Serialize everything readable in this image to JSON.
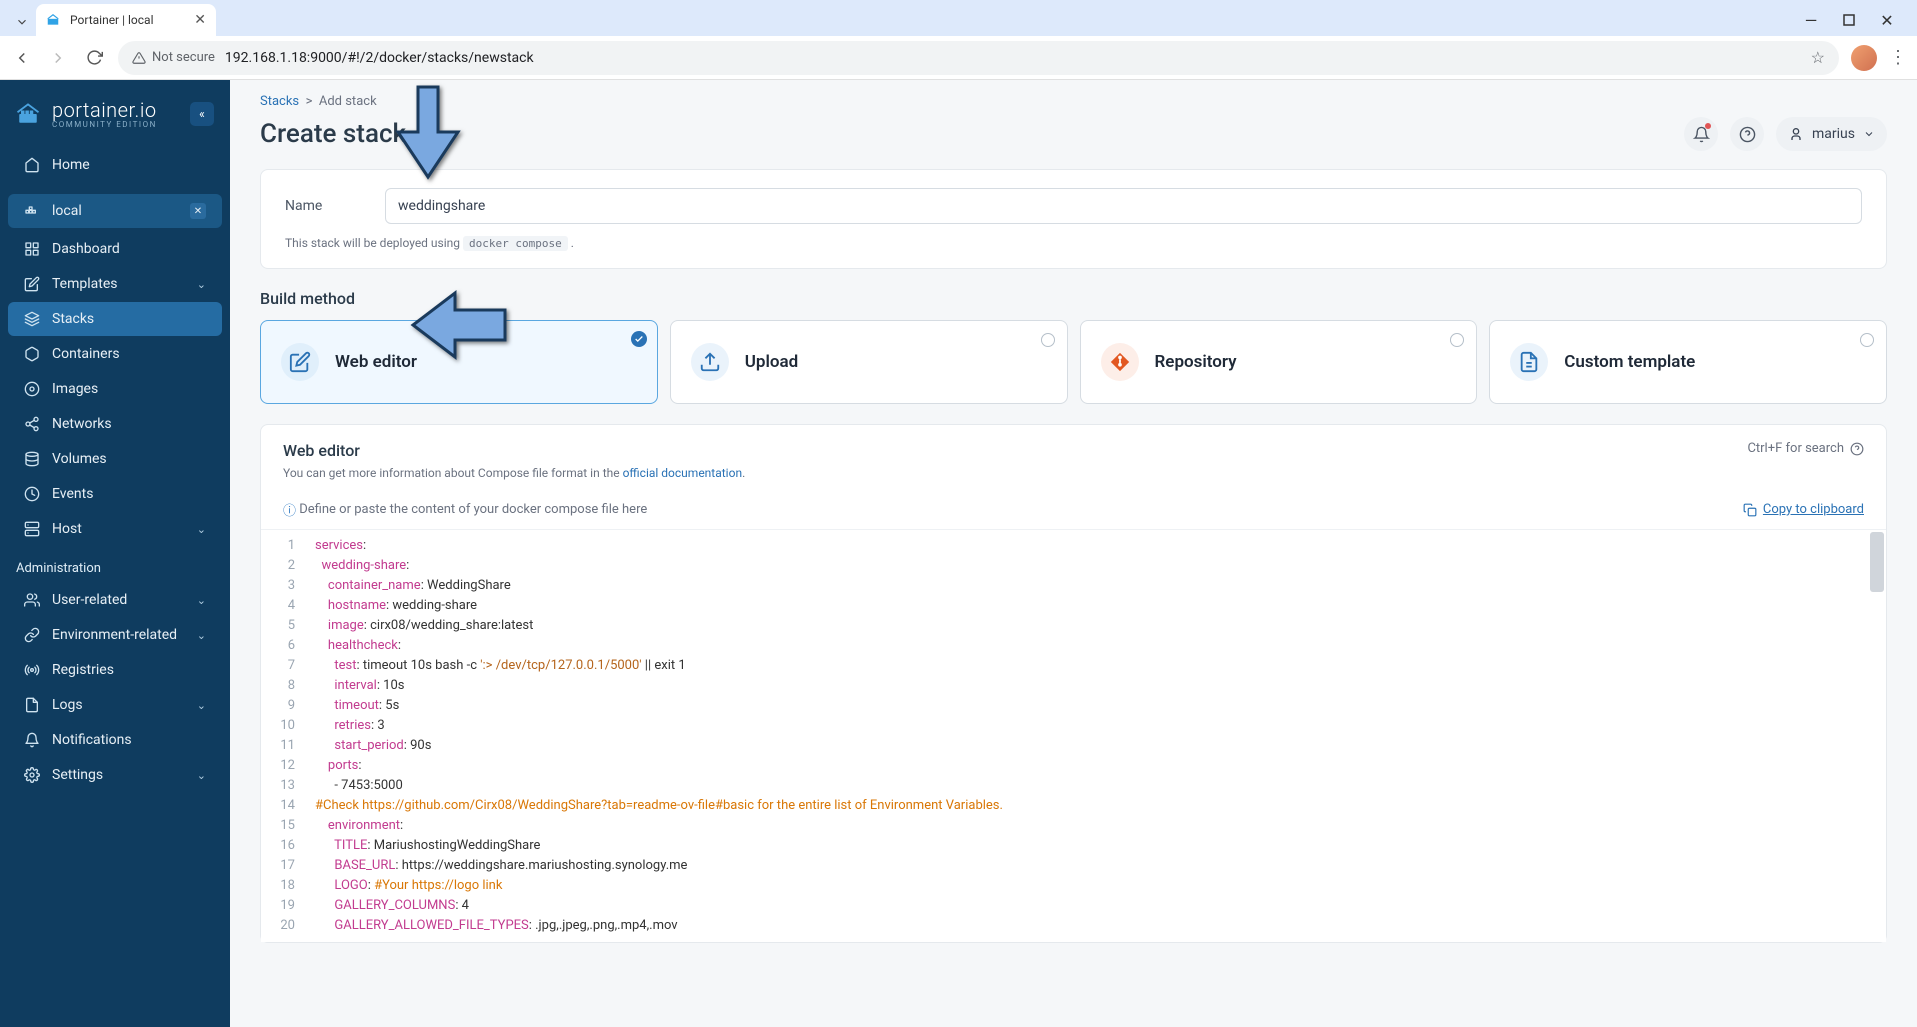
{
  "browser": {
    "tab_title": "Portainer | local",
    "not_secure_label": "Not secure",
    "url": "192.168.1.18:9000/#!/2/docker/stacks/newstack"
  },
  "sidebar": {
    "brand": "portainer.io",
    "edition": "COMMUNITY EDITION",
    "items": [
      {
        "label": "Home",
        "icon": "home"
      },
      {
        "label": "local",
        "icon": "docker",
        "env": true
      },
      {
        "label": "Dashboard",
        "icon": "grid"
      },
      {
        "label": "Templates",
        "icon": "edit",
        "expandable": true
      },
      {
        "label": "Stacks",
        "icon": "layers",
        "active": true
      },
      {
        "label": "Containers",
        "icon": "box"
      },
      {
        "label": "Images",
        "icon": "disc"
      },
      {
        "label": "Networks",
        "icon": "share"
      },
      {
        "label": "Volumes",
        "icon": "database"
      },
      {
        "label": "Events",
        "icon": "clock"
      },
      {
        "label": "Host",
        "icon": "server",
        "expandable": true
      }
    ],
    "admin_label": "Administration",
    "admin_items": [
      {
        "label": "User-related",
        "icon": "users",
        "expandable": true
      },
      {
        "label": "Environment-related",
        "icon": "link",
        "expandable": true
      },
      {
        "label": "Registries",
        "icon": "radio"
      },
      {
        "label": "Logs",
        "icon": "file",
        "expandable": true
      },
      {
        "label": "Notifications",
        "icon": "bell"
      },
      {
        "label": "Settings",
        "icon": "gear",
        "expandable": true
      }
    ]
  },
  "header": {
    "breadcrumb_parent": "Stacks",
    "breadcrumb_current": "Add stack",
    "title": "Create stack",
    "username": "marius"
  },
  "form": {
    "name_label": "Name",
    "name_value": "weddingshare",
    "deploy_note_pre": "This stack will be deployed using ",
    "deploy_cmd": "docker compose",
    "deploy_note_post": " ."
  },
  "build": {
    "section": "Build method",
    "methods": [
      {
        "label": "Web editor",
        "selected": true,
        "color": "#2a72b5"
      },
      {
        "label": "Upload",
        "color": "#2a72b5"
      },
      {
        "label": "Repository",
        "color": "#e25822"
      },
      {
        "label": "Custom template",
        "color": "#2a72b5"
      }
    ]
  },
  "editor": {
    "title": "Web editor",
    "sub_pre": "You can get more information about Compose file format in the ",
    "sub_link": "official documentation",
    "search_hint": "Ctrl+F for search",
    "placeholder": "Define or paste the content of your docker compose file here",
    "copy_label": "Copy to clipboard",
    "lines": [
      [
        {
          "t": "services",
          "c": "k-key"
        },
        {
          "t": ":"
        }
      ],
      [
        {
          "t": "  "
        },
        {
          "t": "wedding-share",
          "c": "k-key"
        },
        {
          "t": ":"
        }
      ],
      [
        {
          "t": "    "
        },
        {
          "t": "container_name",
          "c": "k-key"
        },
        {
          "t": ": WeddingShare"
        }
      ],
      [
        {
          "t": "    "
        },
        {
          "t": "hostname",
          "c": "k-key"
        },
        {
          "t": ": wedding-share"
        }
      ],
      [
        {
          "t": "    "
        },
        {
          "t": "image",
          "c": "k-key"
        },
        {
          "t": ": cirx08/wedding_share:latest"
        }
      ],
      [
        {
          "t": "    "
        },
        {
          "t": "healthcheck",
          "c": "k-key"
        },
        {
          "t": ":"
        }
      ],
      [
        {
          "t": "      "
        },
        {
          "t": "test",
          "c": "k-key"
        },
        {
          "t": ": timeout 10s bash -c "
        },
        {
          "t": "':> /dev/tcp/127.0.0.1/5000'",
          "c": "k-str"
        },
        {
          "t": " || exit 1"
        }
      ],
      [
        {
          "t": "      "
        },
        {
          "t": "interval",
          "c": "k-key"
        },
        {
          "t": ": 10s"
        }
      ],
      [
        {
          "t": "      "
        },
        {
          "t": "timeout",
          "c": "k-key"
        },
        {
          "t": ": 5s"
        }
      ],
      [
        {
          "t": "      "
        },
        {
          "t": "retries",
          "c": "k-key"
        },
        {
          "t": ": 3"
        }
      ],
      [
        {
          "t": "      "
        },
        {
          "t": "start_period",
          "c": "k-key"
        },
        {
          "t": ": 90s"
        }
      ],
      [
        {
          "t": "    "
        },
        {
          "t": "ports",
          "c": "k-key"
        },
        {
          "t": ":"
        }
      ],
      [
        {
          "t": "      - 7453:5000"
        }
      ],
      [
        {
          "t": "#Check https://github.com/Cirx08/WeddingShare?tab=readme-ov-file#basic for the entire list of Environment Variables.",
          "c": "k-cmt"
        }
      ],
      [
        {
          "t": "    "
        },
        {
          "t": "environment",
          "c": "k-key"
        },
        {
          "t": ":"
        }
      ],
      [
        {
          "t": "      "
        },
        {
          "t": "TITLE",
          "c": "k-key"
        },
        {
          "t": ": MariushostingWeddingShare"
        }
      ],
      [
        {
          "t": "      "
        },
        {
          "t": "BASE_URL",
          "c": "k-key"
        },
        {
          "t": ": https://weddingshare.mariushosting.synology.me"
        }
      ],
      [
        {
          "t": "      "
        },
        {
          "t": "LOGO",
          "c": "k-key"
        },
        {
          "t": ": "
        },
        {
          "t": "#Your https://logo link",
          "c": "k-cmt"
        }
      ],
      [
        {
          "t": "      "
        },
        {
          "t": "GALLERY_COLUMNS",
          "c": "k-key"
        },
        {
          "t": ": 4"
        }
      ],
      [
        {
          "t": "      "
        },
        {
          "t": "GALLERY_ALLOWED_FILE_TYPES",
          "c": "k-key"
        },
        {
          "t": ": .jpg,.jpeg,.png,.mp4,.mov"
        }
      ]
    ]
  }
}
